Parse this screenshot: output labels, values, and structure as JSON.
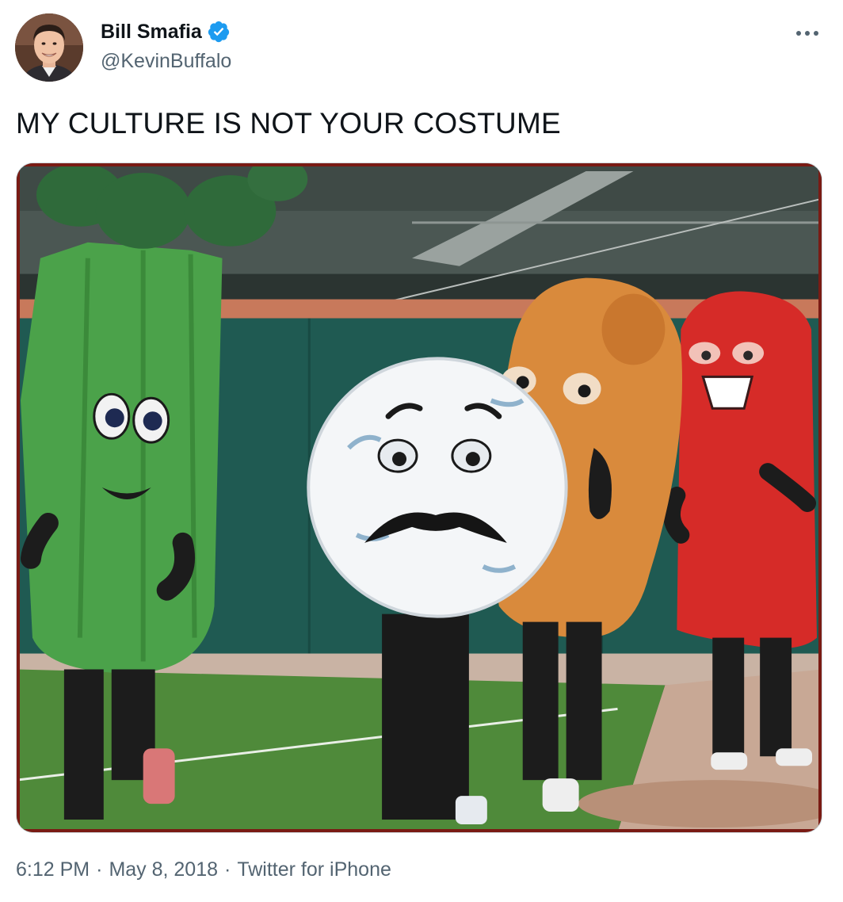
{
  "tweet": {
    "author": {
      "display_name": "Bill Smafia",
      "handle": "@KevinBuffalo",
      "verified": true
    },
    "text": "MY CULTURE IS NOT YOUR COSTUME",
    "time": "6:12 PM",
    "separator": "·",
    "date": "May 8, 2018",
    "source": "Twitter for iPhone"
  },
  "icons": {
    "verified": "verified-badge-icon",
    "more": "more-horizontal-icon"
  },
  "colors": {
    "text_primary": "#0f1419",
    "text_secondary": "#536471",
    "verified_blue": "#1d9bf0",
    "border": "#cfd9de"
  }
}
